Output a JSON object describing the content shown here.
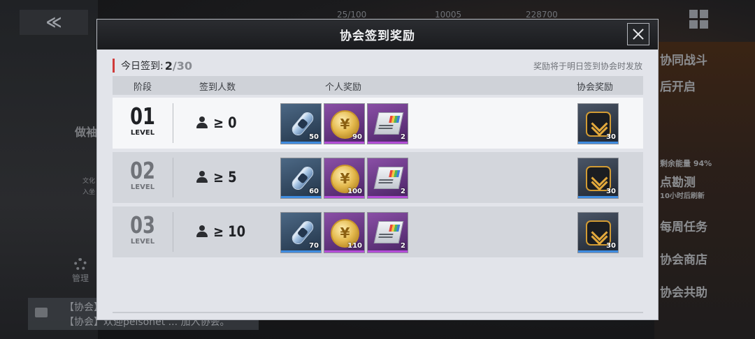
{
  "background": {
    "back_glyph": "≪",
    "resources": [
      "25/100",
      "10005",
      "228700"
    ],
    "left_texts": [
      "做袖",
      "文化",
      "入坐"
    ],
    "manage_label": "管理",
    "chat_lines": [
      "【协会】",
      "【协会】欢迎pelsonet ... 加入协会。"
    ],
    "right_items": [
      "协同战斗",
      "后开启",
      "剩余能量 94%",
      "点勘测",
      "10小时后刷新",
      "每周任务",
      "协会商店",
      "协会共助"
    ]
  },
  "dialog": {
    "title": "协会签到奖励",
    "close_icon": "close-x",
    "today_label": "今日签到:",
    "today_count": "2",
    "today_total": "/30",
    "notice": "奖励将于明日签到协会时发放",
    "columns": {
      "stage": "阶段",
      "checkins": "签到人数",
      "personal_reward": "个人奖励",
      "guild_reward": "协会奖励"
    },
    "level_word": "LEVEL",
    "rows": [
      {
        "level": "01",
        "threshold": "≥ 0",
        "personal": [
          {
            "icon": "capsule-icon",
            "qty": "50"
          },
          {
            "icon": "gold-coin-icon",
            "qty": "90"
          },
          {
            "icon": "chip-card-icon",
            "qty": "2"
          }
        ],
        "guild": {
          "icon": "rank-badge-icon",
          "qty": "30"
        }
      },
      {
        "level": "02",
        "threshold": "≥ 5",
        "personal": [
          {
            "icon": "capsule-icon",
            "qty": "60"
          },
          {
            "icon": "gold-coin-icon",
            "qty": "100"
          },
          {
            "icon": "chip-card-icon",
            "qty": "2"
          }
        ],
        "guild": {
          "icon": "rank-badge-icon",
          "qty": "30"
        }
      },
      {
        "level": "03",
        "threshold": "≥ 10",
        "personal": [
          {
            "icon": "capsule-icon",
            "qty": "70"
          },
          {
            "icon": "gold-coin-icon",
            "qty": "110"
          },
          {
            "icon": "chip-card-icon",
            "qty": "2"
          }
        ],
        "guild": {
          "icon": "rank-badge-icon",
          "qty": "30"
        }
      }
    ]
  },
  "colors": {
    "accent_red": "#d03a3a",
    "blue_rarity": "#3f8ce0",
    "purple_rarity": "#b44dd8",
    "dialog_bg": "#e2e4ea"
  }
}
